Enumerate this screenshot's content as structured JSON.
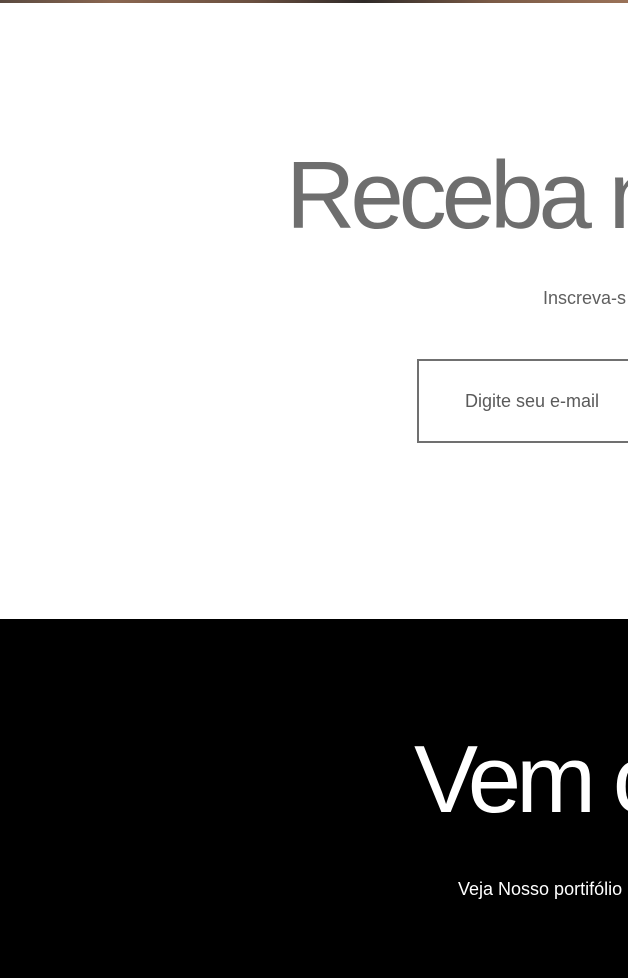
{
  "newsletter": {
    "title": "Receba n",
    "subtitle": "Inscreva-s",
    "email_placeholder": "Digite seu e-mail"
  },
  "portfolio": {
    "title": "Vem c",
    "subtitle": "Veja Nosso portifólio"
  },
  "colors": {
    "newsletter_bg": "#ffffff",
    "newsletter_title": "#6e6e6e",
    "portfolio_bg": "#000000",
    "portfolio_text": "#ffffff"
  }
}
